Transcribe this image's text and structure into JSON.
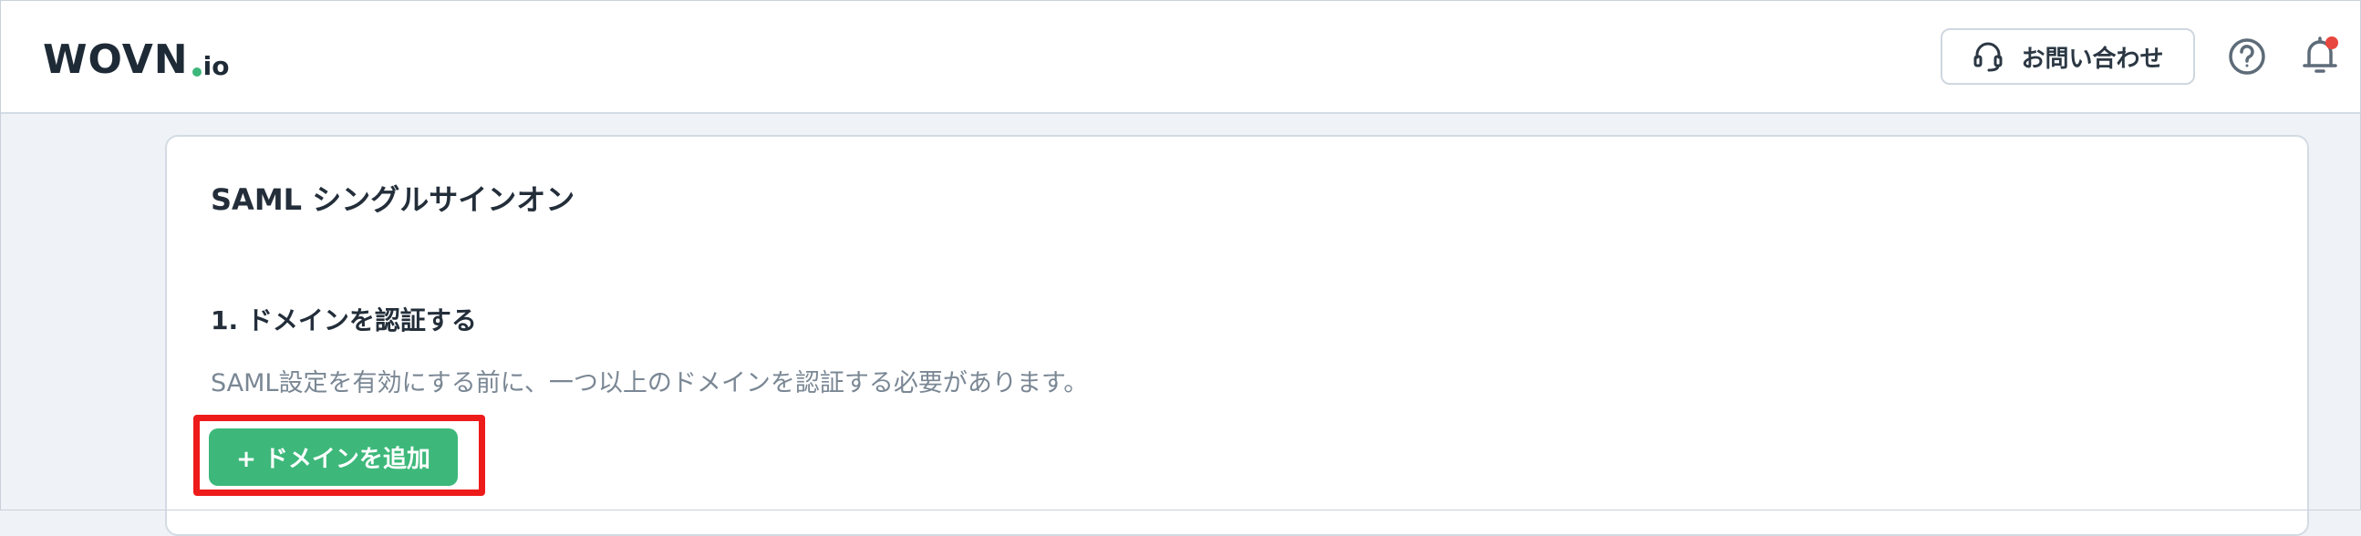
{
  "header": {
    "logo": {
      "main": "WOVN",
      "suffix": "io"
    },
    "contact_button": {
      "label": "お問い合わせ",
      "icon": "headset-icon"
    },
    "help_icon": "question-circle-icon",
    "notification_icon": "bell-icon",
    "notification_badge_color": "#e8473f"
  },
  "main": {
    "card_title": "SAML シングルサインオン",
    "section": {
      "title": "1. ドメインを認証する",
      "description": "SAML設定を有効にする前に、一つ以上のドメインを認証する必要があります。",
      "add_button_label": "+ ドメインを追加"
    }
  },
  "colors": {
    "accent_green": "#3db87a",
    "highlight_red": "#ee1b1b",
    "background": "#eff3f7"
  }
}
